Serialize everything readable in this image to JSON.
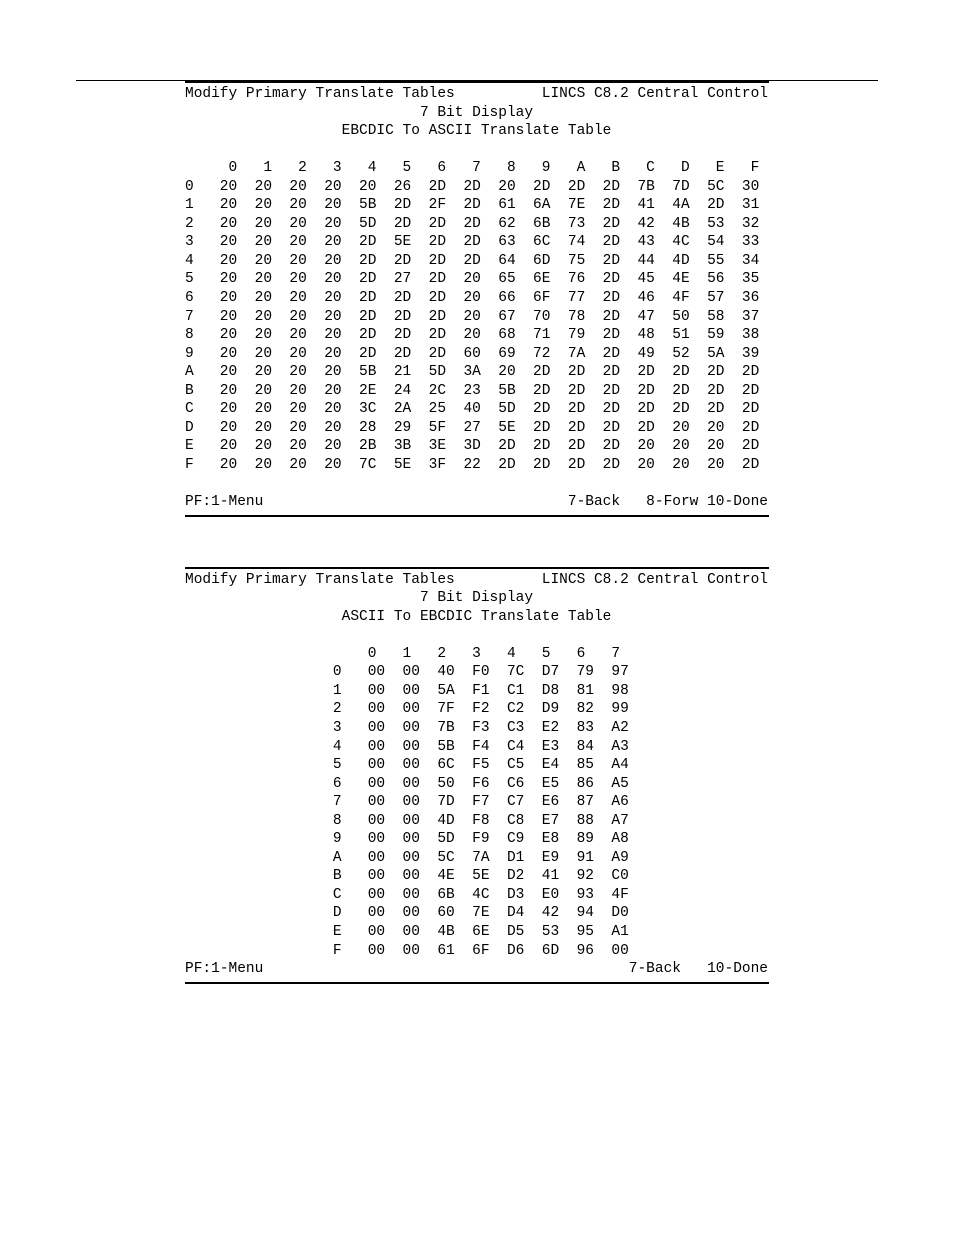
{
  "panel1": {
    "title_left": "Modify Primary Translate Tables",
    "title_right": "LINCS C8.2 Central Control",
    "subtitle1": "7 Bit Display",
    "subtitle2": "EBCDIC To ASCII Translate Table",
    "col_headers": [
      "0",
      "1",
      "2",
      "3",
      "4",
      "5",
      "6",
      "7",
      "8",
      "9",
      "A",
      "B",
      "C",
      "D",
      "E",
      "F"
    ],
    "row_labels": [
      "0",
      "1",
      "2",
      "3",
      "4",
      "5",
      "6",
      "7",
      "8",
      "9",
      "A",
      "B",
      "C",
      "D",
      "E",
      "F"
    ],
    "rows": [
      [
        "20",
        "20",
        "20",
        "20",
        "20",
        "26",
        "2D",
        "2D",
        "20",
        "2D",
        "2D",
        "2D",
        "7B",
        "7D",
        "5C",
        "30"
      ],
      [
        "20",
        "20",
        "20",
        "20",
        "5B",
        "2D",
        "2F",
        "2D",
        "61",
        "6A",
        "7E",
        "2D",
        "41",
        "4A",
        "2D",
        "31"
      ],
      [
        "20",
        "20",
        "20",
        "20",
        "5D",
        "2D",
        "2D",
        "2D",
        "62",
        "6B",
        "73",
        "2D",
        "42",
        "4B",
        "53",
        "32"
      ],
      [
        "20",
        "20",
        "20",
        "20",
        "2D",
        "5E",
        "2D",
        "2D",
        "63",
        "6C",
        "74",
        "2D",
        "43",
        "4C",
        "54",
        "33"
      ],
      [
        "20",
        "20",
        "20",
        "20",
        "2D",
        "2D",
        "2D",
        "2D",
        "64",
        "6D",
        "75",
        "2D",
        "44",
        "4D",
        "55",
        "34"
      ],
      [
        "20",
        "20",
        "20",
        "20",
        "2D",
        "27",
        "2D",
        "20",
        "65",
        "6E",
        "76",
        "2D",
        "45",
        "4E",
        "56",
        "35"
      ],
      [
        "20",
        "20",
        "20",
        "20",
        "2D",
        "2D",
        "2D",
        "20",
        "66",
        "6F",
        "77",
        "2D",
        "46",
        "4F",
        "57",
        "36"
      ],
      [
        "20",
        "20",
        "20",
        "20",
        "2D",
        "2D",
        "2D",
        "20",
        "67",
        "70",
        "78",
        "2D",
        "47",
        "50",
        "58",
        "37"
      ],
      [
        "20",
        "20",
        "20",
        "20",
        "2D",
        "2D",
        "2D",
        "20",
        "68",
        "71",
        "79",
        "2D",
        "48",
        "51",
        "59",
        "38"
      ],
      [
        "20",
        "20",
        "20",
        "20",
        "2D",
        "2D",
        "2D",
        "60",
        "69",
        "72",
        "7A",
        "2D",
        "49",
        "52",
        "5A",
        "39"
      ],
      [
        "20",
        "20",
        "20",
        "20",
        "5B",
        "21",
        "5D",
        "3A",
        "20",
        "2D",
        "2D",
        "2D",
        "2D",
        "2D",
        "2D",
        "2D"
      ],
      [
        "20",
        "20",
        "20",
        "20",
        "2E",
        "24",
        "2C",
        "23",
        "5B",
        "2D",
        "2D",
        "2D",
        "2D",
        "2D",
        "2D",
        "2D"
      ],
      [
        "20",
        "20",
        "20",
        "20",
        "3C",
        "2A",
        "25",
        "40",
        "5D",
        "2D",
        "2D",
        "2D",
        "2D",
        "2D",
        "2D",
        "2D"
      ],
      [
        "20",
        "20",
        "20",
        "20",
        "28",
        "29",
        "5F",
        "27",
        "5E",
        "2D",
        "2D",
        "2D",
        "2D",
        "20",
        "20",
        "2D"
      ],
      [
        "20",
        "20",
        "20",
        "20",
        "2B",
        "3B",
        "3E",
        "3D",
        "2D",
        "2D",
        "2D",
        "2D",
        "20",
        "20",
        "20",
        "2D"
      ],
      [
        "20",
        "20",
        "20",
        "20",
        "7C",
        "5E",
        "3F",
        "22",
        "2D",
        "2D",
        "2D",
        "2D",
        "20",
        "20",
        "20",
        "2D"
      ]
    ],
    "footer_left": "PF:1-Menu",
    "footer_right": "7-Back   8-Forw 10-Done"
  },
  "panel2": {
    "title_left": "Modify Primary Translate Tables",
    "title_right": "LINCS C8.2 Central Control",
    "subtitle1": "7 Bit Display",
    "subtitle2": "ASCII To EBCDIC Translate Table",
    "col_headers": [
      "0",
      "1",
      "2",
      "3",
      "4",
      "5",
      "6",
      "7"
    ],
    "row_labels": [
      "0",
      "1",
      "2",
      "3",
      "4",
      "5",
      "6",
      "7",
      "8",
      "9",
      "A",
      "B",
      "C",
      "D",
      "E",
      "F"
    ],
    "rows": [
      [
        "00",
        "00",
        "40",
        "F0",
        "7C",
        "D7",
        "79",
        "97"
      ],
      [
        "00",
        "00",
        "5A",
        "F1",
        "C1",
        "D8",
        "81",
        "98"
      ],
      [
        "00",
        "00",
        "7F",
        "F2",
        "C2",
        "D9",
        "82",
        "99"
      ],
      [
        "00",
        "00",
        "7B",
        "F3",
        "C3",
        "E2",
        "83",
        "A2"
      ],
      [
        "00",
        "00",
        "5B",
        "F4",
        "C4",
        "E3",
        "84",
        "A3"
      ],
      [
        "00",
        "00",
        "6C",
        "F5",
        "C5",
        "E4",
        "85",
        "A4"
      ],
      [
        "00",
        "00",
        "50",
        "F6",
        "C6",
        "E5",
        "86",
        "A5"
      ],
      [
        "00",
        "00",
        "7D",
        "F7",
        "C7",
        "E6",
        "87",
        "A6"
      ],
      [
        "00",
        "00",
        "4D",
        "F8",
        "C8",
        "E7",
        "88",
        "A7"
      ],
      [
        "00",
        "00",
        "5D",
        "F9",
        "C9",
        "E8",
        "89",
        "A8"
      ],
      [
        "00",
        "00",
        "5C",
        "7A",
        "D1",
        "E9",
        "91",
        "A9"
      ],
      [
        "00",
        "00",
        "4E",
        "5E",
        "D2",
        "41",
        "92",
        "C0"
      ],
      [
        "00",
        "00",
        "6B",
        "4C",
        "D3",
        "E0",
        "93",
        "4F"
      ],
      [
        "00",
        "00",
        "60",
        "7E",
        "D4",
        "42",
        "94",
        "D0"
      ],
      [
        "00",
        "00",
        "4B",
        "6E",
        "D5",
        "53",
        "95",
        "A1"
      ],
      [
        "00",
        "00",
        "61",
        "6F",
        "D6",
        "6D",
        "96",
        "00"
      ]
    ],
    "footer_left": "PF:1-Menu",
    "footer_right": "7-Back   10-Done"
  }
}
